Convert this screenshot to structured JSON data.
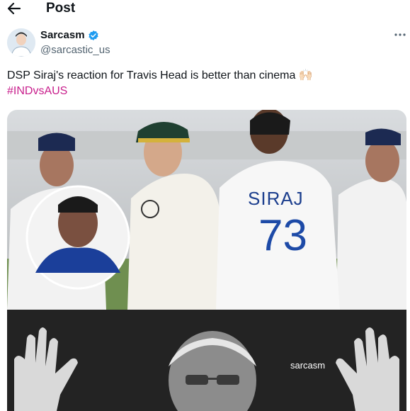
{
  "header": {
    "back_icon": "arrow-left-icon",
    "title": "Post"
  },
  "author": {
    "name": "Sarcasm",
    "handle": "@sarcastic_us",
    "verified_icon": "verified-badge-icon",
    "verified_color": "#1d9bf0"
  },
  "menu": {
    "more_icon": "more-options-icon"
  },
  "tweet": {
    "text": "DSP Siraj's reaction for Travis Head is better than cinema 🙌🏻",
    "hashtag": "#INDvsAUS",
    "hashtag_color": "#c81e8c"
  },
  "media": {
    "jersey_name": "SIRAJ",
    "jersey_number": "73",
    "watermark": "sarcasm"
  }
}
